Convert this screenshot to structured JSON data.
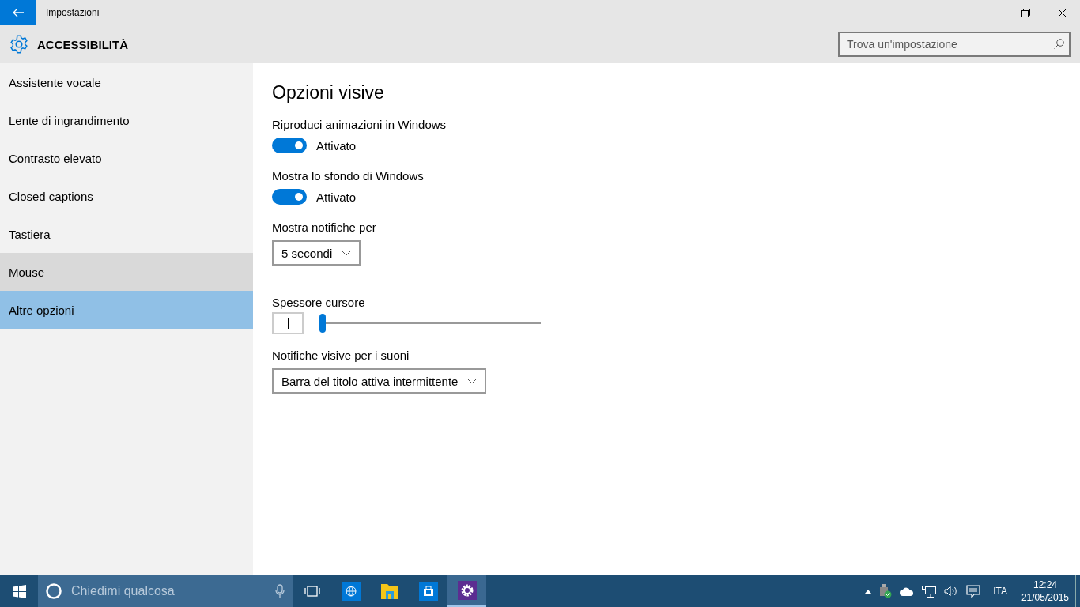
{
  "window": {
    "title": "Impostazioni"
  },
  "header": {
    "title": "ACCESSIBILITÀ",
    "search": {
      "placeholder": "Trova un'impostazione"
    }
  },
  "sidebar": {
    "items": [
      {
        "label": "Assistente vocale",
        "selected": false,
        "hovered": false
      },
      {
        "label": "Lente di ingrandimento",
        "selected": false,
        "hovered": false
      },
      {
        "label": "Contrasto elevato",
        "selected": false,
        "hovered": false
      },
      {
        "label": "Closed captions",
        "selected": false,
        "hovered": false
      },
      {
        "label": "Tastiera",
        "selected": false,
        "hovered": false
      },
      {
        "label": "Mouse",
        "selected": false,
        "hovered": true
      },
      {
        "label": "Altre opzioni",
        "selected": true,
        "hovered": false
      }
    ]
  },
  "content": {
    "heading": "Opzioni visive",
    "settings": [
      {
        "kind": "toggle",
        "label": "Riproduci animazioni in Windows",
        "on": true,
        "state": "Attivato"
      },
      {
        "kind": "toggle",
        "label": "Mostra lo sfondo di Windows",
        "on": true,
        "state": "Attivato"
      },
      {
        "kind": "dropdown",
        "label": "Mostra notifiche per",
        "value": "5 secondi"
      },
      {
        "kind": "slider",
        "label": "Spessore cursore",
        "level": 0
      },
      {
        "kind": "dropdown",
        "label": "Notifiche visive per i suoni",
        "value": "Barra del titolo attiva intermittente"
      }
    ]
  },
  "taskbar": {
    "search": {
      "placeholder": "Chiedimi qualcosa"
    },
    "apps": [
      {
        "kind": "task-view",
        "active": false
      },
      {
        "kind": "browser",
        "active": false
      },
      {
        "kind": "folder",
        "active": false
      },
      {
        "kind": "store",
        "active": false
      },
      {
        "kind": "settings",
        "active": true
      }
    ],
    "language": "ITA",
    "time": "12:24",
    "date": "21/05/2015"
  }
}
